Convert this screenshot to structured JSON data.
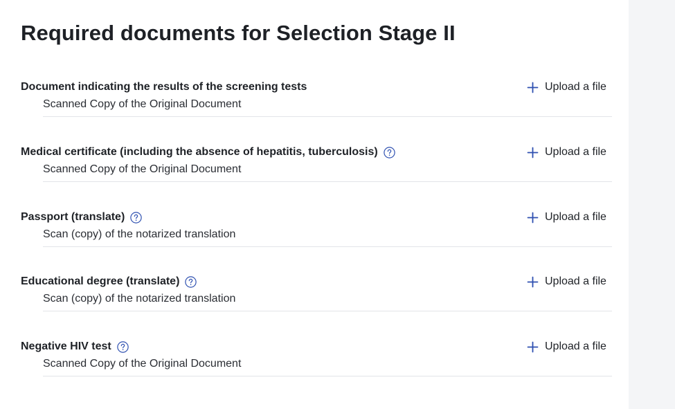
{
  "page": {
    "title": "Required documents for Selection Stage II"
  },
  "colors": {
    "accent": "#2d4fb0",
    "divider": "#e2e4e8",
    "sidebar_bg": "#f4f5f7"
  },
  "documents": [
    {
      "title": "Document indicating the results of the screening tests",
      "subtitle": "Scanned Copy of the Original Document",
      "has_help": false,
      "upload_label": "Upload a file",
      "upload_icon": "plus-icon"
    },
    {
      "title": "Medical certificate (including the absence of hepatitis, tuberculosis)",
      "subtitle": "Scanned Copy of the Original Document",
      "has_help": true,
      "help_icon": "question-circle-icon",
      "upload_label": "Upload a file",
      "upload_icon": "plus-icon"
    },
    {
      "title": "Passport (translate)",
      "subtitle": "Scan (copy) of the notarized translation",
      "has_help": true,
      "help_icon": "question-circle-icon",
      "upload_label": "Upload a file",
      "upload_icon": "plus-icon"
    },
    {
      "title": "Educational degree (translate)",
      "subtitle": "Scan (copy) of the notarized translation",
      "has_help": true,
      "help_icon": "question-circle-icon",
      "upload_label": "Upload a file",
      "upload_icon": "plus-icon"
    },
    {
      "title": "Negative HIV test",
      "subtitle": "Scanned Copy of the Original Document",
      "has_help": true,
      "help_icon": "question-circle-icon",
      "upload_label": "Upload a file",
      "upload_icon": "plus-icon"
    }
  ]
}
